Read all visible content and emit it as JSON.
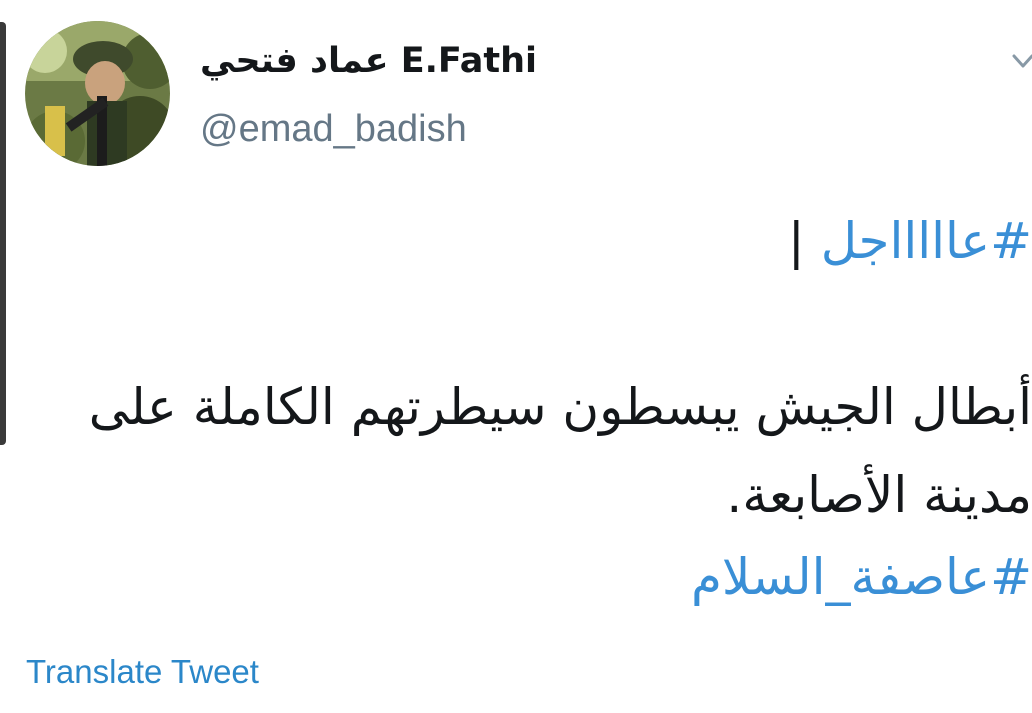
{
  "header": {
    "display_name": "عماد فتحي E.Fathi",
    "handle": "@emad_badish",
    "menu_icon": "chevron-down-icon"
  },
  "avatar": {
    "icon": "avatar-photo"
  },
  "tweet": {
    "line1_hashtag": "#عاااااجل",
    "line1_separator": "|",
    "line2": "أبطال الجيش يبسطون سيطرتهم الكاملة على",
    "line3": "مدينة الأصابعة.",
    "line4_hashtag": "#عاصفة_السلام"
  },
  "actions": {
    "translate_label": "Translate Tweet"
  },
  "colors": {
    "link": "#3a8fd6",
    "handle": "#657786",
    "text": "#14171a"
  }
}
